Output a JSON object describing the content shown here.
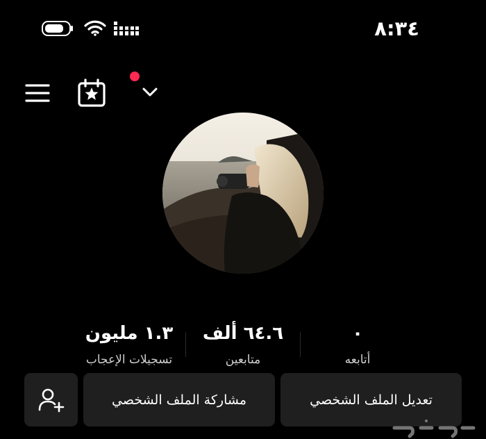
{
  "status_bar": {
    "time": "٨:٣٤",
    "battery_level": 0.75,
    "battery_icon": "battery-icon",
    "wifi_icon": "wifi-icon",
    "signal_icon": "signal-icon"
  },
  "top_nav": {
    "menu_icon": "hamburger-menu-icon",
    "calendar_icon": "calendar-star-icon",
    "notification_dot_color": "#ff2a51",
    "dropdown_icon": "chevron-down-icon"
  },
  "profile": {
    "avatar": "profile-photo"
  },
  "stats": {
    "likes": {
      "value": "١.٣ مليون",
      "label": "تسجيلات الإعجاب"
    },
    "followers": {
      "value": "٦٤.٦ ألف",
      "label": "متابعين"
    },
    "following": {
      "value": "٠",
      "label": "أتابعه"
    }
  },
  "actions": {
    "edit_profile": "تعديل الملف الشخصي",
    "share_profile": "مشاركة الملف الشخصي",
    "add_friend_icon": "add-user-icon"
  },
  "watermark": {
    "text": "حراج"
  }
}
